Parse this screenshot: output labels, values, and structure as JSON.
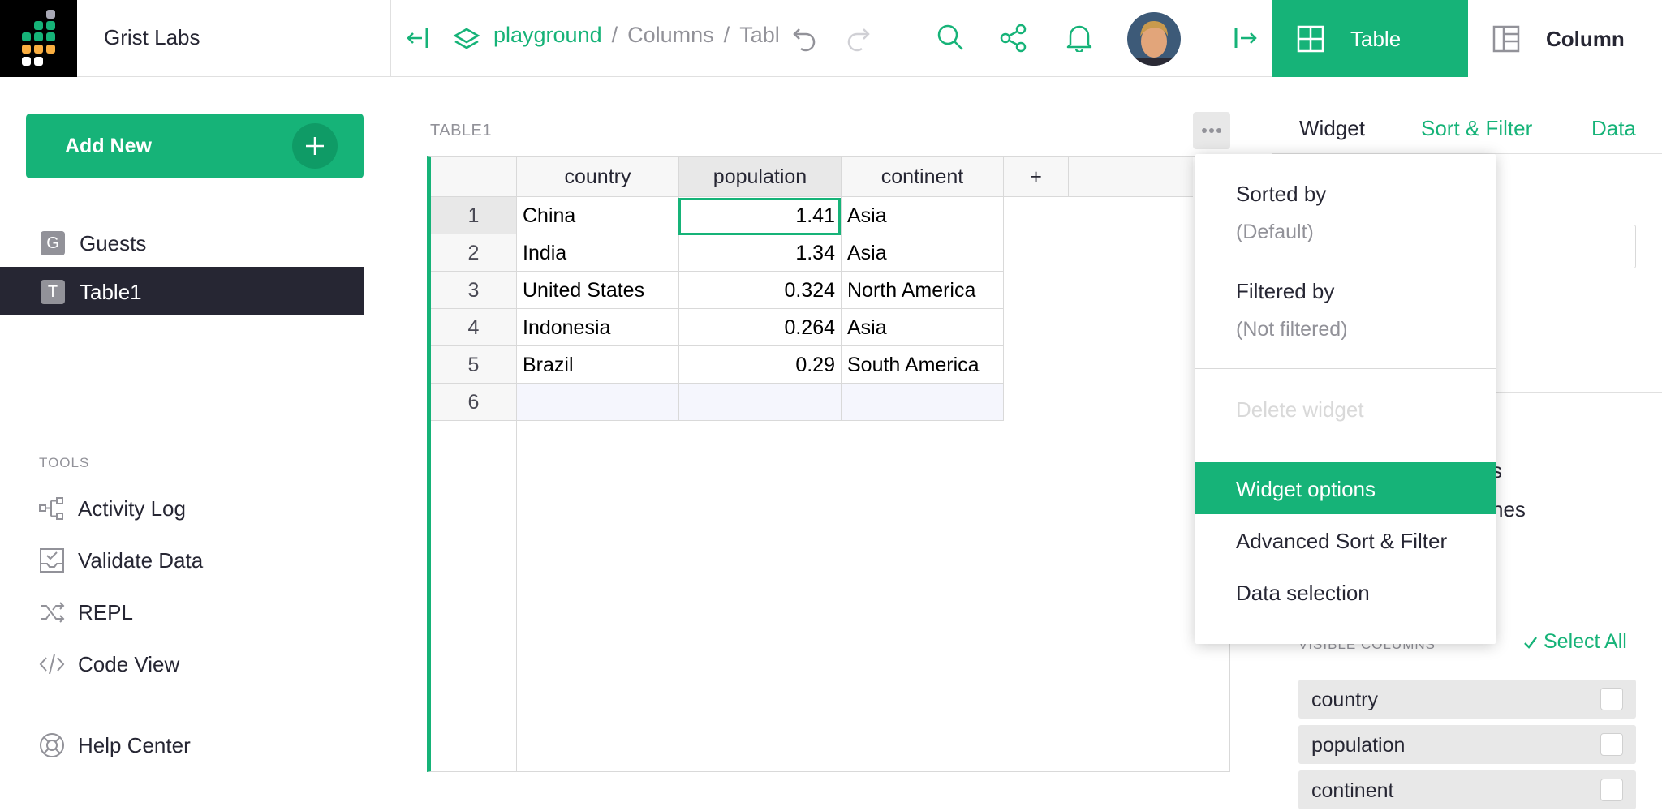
{
  "app": {
    "org_name": "Grist Labs"
  },
  "breadcrumb": {
    "workspace": "playground",
    "separator": "/",
    "document": "Columns",
    "page": "Tabl"
  },
  "right_tabs": {
    "table": "Table",
    "column": "Column"
  },
  "left_panel": {
    "add_new": "Add New",
    "pages": [
      {
        "icon_letter": "G",
        "label": "Guests"
      },
      {
        "icon_letter": "T",
        "label": "Table1"
      }
    ],
    "tools_heading": "TOOLS",
    "tools": [
      {
        "icon": "activity-log-icon",
        "label": "Activity Log"
      },
      {
        "icon": "validate-data-icon",
        "label": "Validate Data"
      },
      {
        "icon": "repl-icon",
        "label": "REPL"
      },
      {
        "icon": "code-view-icon",
        "label": "Code View"
      }
    ],
    "help": {
      "icon": "lifebuoy-icon",
      "label": "Help Center"
    }
  },
  "widget": {
    "title": "TABLE1",
    "columns": [
      "country",
      "population",
      "continent"
    ],
    "add_column": "+",
    "rows": [
      {
        "n": "1",
        "country": "China",
        "population": "1.41",
        "continent": "Asia"
      },
      {
        "n": "2",
        "country": "India",
        "population": "1.34",
        "continent": "Asia"
      },
      {
        "n": "3",
        "country": "United States",
        "population": "0.324",
        "continent": "North America"
      },
      {
        "n": "4",
        "country": "Indonesia",
        "population": "0.264",
        "continent": "Asia"
      },
      {
        "n": "5",
        "country": "Brazil",
        "population": "0.29",
        "continent": "South America"
      }
    ],
    "new_row_number": "6"
  },
  "right_panel": {
    "subtabs": {
      "widget": "Widget",
      "sort_filter": "Sort & Filter",
      "data": "Data"
    },
    "partial_text_1": "s",
    "partial_text_2": "nes",
    "visible_columns_heading": "VISIBLE COLUMNS",
    "select_all": "Select All",
    "visible_columns": [
      "country",
      "population",
      "continent"
    ]
  },
  "menu": {
    "sorted_by": "Sorted by",
    "sorted_value": "(Default)",
    "filtered_by": "Filtered by",
    "filtered_value": "(Not filtered)",
    "delete_widget": "Delete widget",
    "widget_options": "Widget options",
    "advanced_sort_filter": "Advanced Sort & Filter",
    "data_selection": "Data selection"
  },
  "colors": {
    "accent": "#16b378",
    "dark": "#262633",
    "muted": "#929299"
  }
}
